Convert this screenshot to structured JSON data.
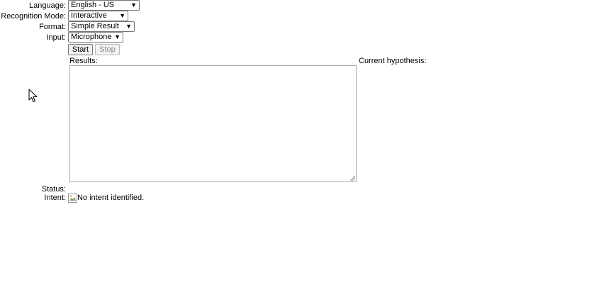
{
  "language": {
    "label": "Language:",
    "value": "English - US"
  },
  "recognition_mode": {
    "label": "Recognition Mode:",
    "value": "Interactive"
  },
  "format": {
    "label": "Format:",
    "value": "Simple Result"
  },
  "input": {
    "label": "Input:",
    "value": "Microphone"
  },
  "buttons": {
    "start": "Start",
    "stop": "Stop"
  },
  "results": {
    "label": "Results:",
    "text": ""
  },
  "current_hypothesis": {
    "label": "Current hypothesis:"
  },
  "status": {
    "label": "Status:",
    "value": ""
  },
  "intent": {
    "label": "Intent:",
    "value": "No intent identified."
  },
  "icons": {
    "dropdown": "chevron-down-icon",
    "image": "broken-image-icon",
    "pointer": "mouse-cursor-icon"
  }
}
